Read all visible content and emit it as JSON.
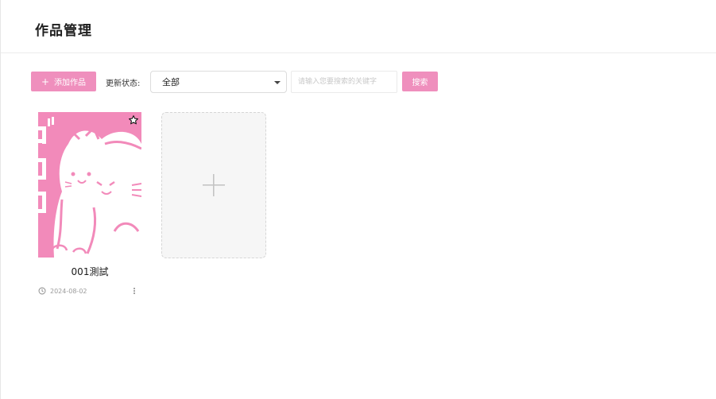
{
  "header": {
    "title": "作品管理"
  },
  "toolbar": {
    "add_label": "添加作品",
    "status_label": "更新状态:",
    "status_selected": "全部",
    "search_placeholder": "请输入您要搜索的关键字",
    "search_label": "搜索"
  },
  "works": [
    {
      "title": "001測試",
      "date": "2024-08-02",
      "cover_icon": "cat-illustration",
      "favorite_icon": "star-outline-icon"
    }
  ],
  "add_card": {
    "icon": "plus-icon"
  },
  "colors": {
    "accent": "#ef8fbd",
    "cover_pink": "#f28aba"
  }
}
